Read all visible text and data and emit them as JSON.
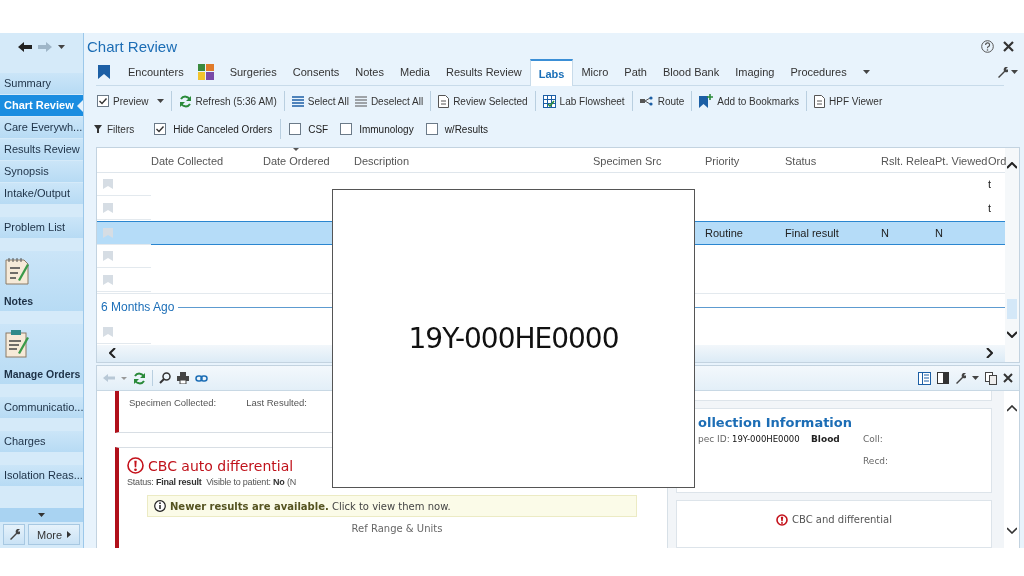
{
  "window": {
    "title": "Chart Review"
  },
  "nav": {
    "groups": [
      [
        {
          "label": "Summary",
          "kind": "link",
          "selected": false
        },
        {
          "label": "Chart Review",
          "kind": "link",
          "selected": true
        },
        {
          "label": "Care Everywh...",
          "kind": "link",
          "selected": false
        },
        {
          "label": "Results Review",
          "kind": "link",
          "selected": false
        },
        {
          "label": "Synopsis",
          "kind": "link",
          "selected": false
        },
        {
          "label": "Intake/Output",
          "kind": "link",
          "selected": false
        }
      ],
      [
        {
          "label": "Problem List",
          "kind": "link",
          "selected": false
        }
      ],
      [
        {
          "label": "Notes",
          "kind": "notes",
          "selected": false
        }
      ],
      [
        {
          "label": "Manage Orders",
          "kind": "orders",
          "selected": false
        }
      ],
      [
        {
          "label": "Communicatio...",
          "kind": "link",
          "selected": false
        }
      ],
      [
        {
          "label": "Charges",
          "kind": "link",
          "selected": false
        }
      ],
      [
        {
          "label": "Isolation Reas...",
          "kind": "link",
          "selected": false
        }
      ]
    ],
    "more": "More"
  },
  "tabs": [
    {
      "label": "Encounters",
      "selected": false
    },
    {
      "label": "Surgeries",
      "selected": false
    },
    {
      "label": "Consents",
      "selected": false
    },
    {
      "label": "Notes",
      "selected": false
    },
    {
      "label": "Media",
      "selected": false
    },
    {
      "label": "Results Review",
      "selected": false
    },
    {
      "label": "Labs",
      "selected": true
    },
    {
      "label": "Micro",
      "selected": false
    },
    {
      "label": "Path",
      "selected": false
    },
    {
      "label": "Blood Bank",
      "selected": false
    },
    {
      "label": "Imaging",
      "selected": false
    },
    {
      "label": "Procedures",
      "selected": false
    }
  ],
  "toolbar": [
    [
      {
        "label": "Preview",
        "kind": "preview"
      }
    ],
    [
      {
        "label": "Refresh (5:36 AM)",
        "kind": "refresh"
      }
    ],
    [
      {
        "label": "Select All",
        "kind": "select_all"
      },
      {
        "label": "Deselect All",
        "kind": "deselect_all"
      }
    ],
    [
      {
        "label": "Review Selected",
        "kind": "document"
      }
    ],
    [
      {
        "label": "Lab Flowsheet",
        "kind": "flowsheet"
      }
    ],
    [
      {
        "label": "Route",
        "kind": "route"
      }
    ],
    [
      {
        "label": "Add to Bookmarks",
        "kind": "bookmark"
      }
    ],
    [
      {
        "label": "HPF Viewer",
        "kind": "document"
      }
    ]
  ],
  "filters": {
    "label": "Filters",
    "groups": [
      [
        {
          "label": "Hide Canceled Orders",
          "checked": true
        }
      ],
      [
        {
          "label": "CSF",
          "checked": false
        },
        {
          "label": "Immunology",
          "checked": false
        },
        {
          "label": "w/Results",
          "checked": false
        }
      ]
    ]
  },
  "table": {
    "columns": [
      {
        "label": "Date Collected",
        "sorted": false
      },
      {
        "label": "Date Ordered",
        "sorted": true
      },
      {
        "label": "Description",
        "sorted": false
      },
      {
        "label": "Specimen Src",
        "sorted": false
      },
      {
        "label": "Priority",
        "sorted": false
      },
      {
        "label": "Status",
        "sorted": false
      },
      {
        "label": "Rslt. Relea",
        "sorted": false
      },
      {
        "label": "Pt. Viewed",
        "sorted": false
      },
      {
        "label": "Ord",
        "sorted": false
      }
    ],
    "rows": [
      {
        "kind": "row",
        "selected": false,
        "cells": {
          "ord": "t"
        }
      },
      {
        "kind": "row",
        "selected": false,
        "cells": {
          "ord": "t"
        }
      },
      {
        "kind": "row",
        "selected": true,
        "cells": {
          "priority": "Routine",
          "status": "Final result",
          "rslt_released": "N",
          "pt_viewed": "N"
        }
      },
      {
        "kind": "row",
        "selected": false,
        "cells": {}
      },
      {
        "kind": "row",
        "selected": false,
        "cells": {}
      },
      {
        "kind": "group",
        "label": "6 Months Ago"
      },
      {
        "kind": "row",
        "selected": false,
        "cells": {}
      }
    ]
  },
  "detail": {
    "left": [
      {
        "kind": "specimen",
        "fields": [
          "Specimen Collected:",
          "Last Resulted:"
        ]
      },
      {
        "kind": "result",
        "title": "CBC auto differential",
        "status": "Status: **Final result**  Visible to patient: **No** (N",
        "notice": "**Newer results are available.** Click to view them now.",
        "column_header": "Ref Range & Units"
      }
    ],
    "right": [
      {
        "kind": "collection",
        "title": "ollection Information",
        "label": "pec ID:",
        "spec_id": "19Y-000HE0000",
        "source": "Blood",
        "coll": "Coll:",
        "recd": "Recd:"
      },
      {
        "kind": "alert",
        "text": "CBC and differential"
      }
    ]
  },
  "overlay": {
    "text": "19Y-000HE0000"
  }
}
